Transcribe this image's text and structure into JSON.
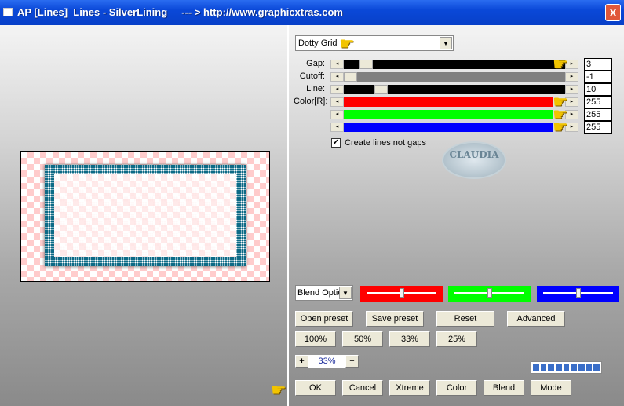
{
  "window": {
    "title": "AP [Lines]  Lines - SilverLining     --- > http://www.graphicxtras.com",
    "close_label": "X"
  },
  "filter": {
    "selected": "Dotty Grid"
  },
  "sliders": [
    {
      "label": "Gap:",
      "value": "3",
      "color": "#000000",
      "fraction": 0.03
    },
    {
      "label": "Cutoff:",
      "value": "-1",
      "color": "#808080",
      "fraction": 0.0
    },
    {
      "label": "Line:",
      "value": "10",
      "color": "#000000",
      "fraction": 0.1
    },
    {
      "label": "Color[R]:",
      "value": "255",
      "color": "#ff0000",
      "fraction": 1.0
    },
    {
      "label": "",
      "value": "255",
      "color": "#00ff00",
      "fraction": 1.0
    },
    {
      "label": "",
      "value": "255",
      "color": "#0000ff",
      "fraction": 1.0
    }
  ],
  "checkbox": {
    "label": "Create lines not gaps",
    "checked": true
  },
  "logo": {
    "text": "CLAUDIA"
  },
  "blend": {
    "selected": "Blend Options",
    "display": "Blend Optio"
  },
  "color_sliders": [
    {
      "color": "#ff0000",
      "fraction": 0.5
    },
    {
      "color": "#00ff00",
      "fraction": 0.5
    },
    {
      "color": "#0000ff",
      "fraction": 0.5
    }
  ],
  "preset_buttons": [
    "Open preset",
    "Save preset",
    "Reset",
    "Advanced"
  ],
  "zoom_buttons": [
    "100%",
    "50%",
    "33%",
    "25%"
  ],
  "zoom": {
    "plus": "+",
    "value": "33%",
    "minus": "−"
  },
  "action_buttons": [
    "OK",
    "Cancel",
    "Xtreme",
    "Color",
    "Blend",
    "Mode"
  ],
  "pointer_icon": "☛"
}
